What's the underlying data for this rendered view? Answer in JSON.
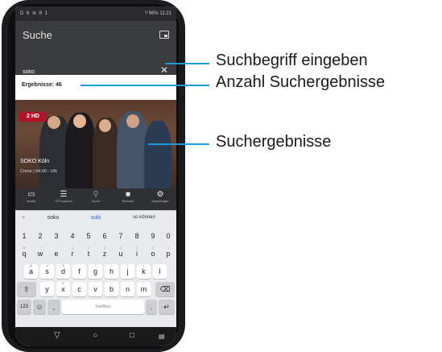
{
  "statusbar": {
    "left": "D 6 ⊘ 8 1",
    "right": "⅟ 96% 11:21"
  },
  "appbar": {
    "title": "Suche",
    "cast_icon": "cast-icon"
  },
  "search": {
    "value": "soko",
    "clear_icon": "close-icon"
  },
  "results": {
    "count_label": "Ergebnisse: 46",
    "item": {
      "channel": "2 HD",
      "title": "SOKO Köln",
      "subtitle": "Crime | 04:00 - UN"
    }
  },
  "bottom_nav": [
    {
      "icon": "tv-icon",
      "glyph": "▭",
      "label": "Sender"
    },
    {
      "icon": "list-icon",
      "glyph": "☰",
      "label": "TV-Programm"
    },
    {
      "icon": "search-icon",
      "glyph": "⚲",
      "label": "Suche"
    },
    {
      "icon": "video-icon",
      "glyph": "■",
      "label": "Rekorder"
    },
    {
      "icon": "gear-icon",
      "glyph": "⚙",
      "label": "Einstellungen"
    }
  ],
  "keyboard": {
    "suggestions": [
      "soko",
      "solo",
      "so können"
    ],
    "plus": "+",
    "row1": [
      "1",
      "2",
      "3",
      "4",
      "5",
      "6",
      "7",
      "8",
      "9",
      "0"
    ],
    "row2": [
      "q",
      "w",
      "e",
      "r",
      "t",
      "z",
      "u",
      "i",
      "o",
      "p"
    ],
    "row2_hints": [
      "%",
      "^",
      "~",
      "|",
      "[",
      "]",
      "<",
      ">",
      "{",
      "}"
    ],
    "row3": [
      "a",
      "s",
      "d",
      "f",
      "g",
      "h",
      "j",
      "k",
      "l"
    ],
    "row3_hints": [
      "@",
      "#",
      "$",
      "-",
      "+",
      "=",
      "(",
      ")",
      ""
    ],
    "row4": [
      "y",
      "x",
      "c",
      "v",
      "b",
      "n",
      "m"
    ],
    "row4_hints": [
      "-",
      "€",
      "'",
      "'",
      ":",
      ";",
      "/"
    ],
    "num_key": "123",
    "emoji_icon": "emoji-icon",
    "comma": ",",
    "space_label": "SwiftKey",
    "period": ".",
    "shift_icon": "shift-icon",
    "backspace_icon": "backspace-icon",
    "enter_icon": "enter-icon"
  },
  "callouts": [
    {
      "text": "Suchbegriff eingeben"
    },
    {
      "text": "Anzahl Suchergebnisse"
    },
    {
      "text": "Suchergebnisse"
    }
  ],
  "colors": {
    "accent": "#1d9bd9",
    "appbar": "#3a3b3d",
    "keyboard": "#e8eaed"
  }
}
